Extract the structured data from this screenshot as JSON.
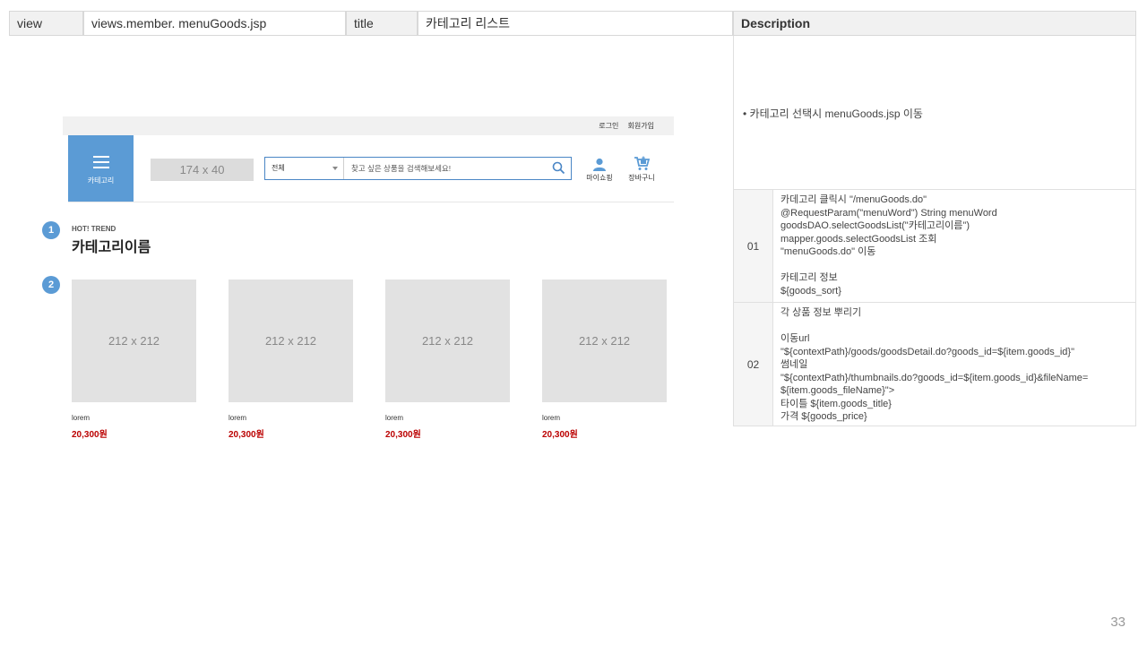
{
  "header": {
    "view_label": "view",
    "view_value": "views.member. menuGoods.jsp",
    "title_label": "title",
    "title_value": "카테고리 리스트"
  },
  "description": {
    "heading": "Description",
    "bullet": "카테고리 선택시 menuGoods.jsp  이동",
    "rows": [
      {
        "num": "01",
        "lines": [
          "카데고리 클릭시 \"/menuGoods.do\"",
          "@RequestParam(\"menuWord\") String menuWord",
          "goodsDAO.selectGoodsList(\"카테고리이름\")",
          "mapper.goods.selectGoodsList 조회",
          "\"menuGoods.do\" 이동",
          "",
          "카테고리 정보",
          "${goods_sort}"
        ]
      },
      {
        "num": "02",
        "lines": [
          "각 상품 정보 뿌리기",
          "",
          "이동url",
          "\"${contextPath}/goods/goodsDetail.do?goods_id=${item.goods_id}\"",
          "썸네일",
          "\"${contextPath}/thumbnails.do?goods_id=${item.goods_id}&fileName=",
          "${item.goods_fileName}\">",
          "타이틀 ${item.goods_title}",
          "가격  ${goods_price}"
        ]
      }
    ]
  },
  "mock": {
    "top_links": [
      "로그인",
      "회원가입"
    ],
    "category_button": "카테고리",
    "logo_placeholder": "174 x 40",
    "search_select": "전체",
    "search_placeholder": "찾고 싶은 상품을 검색해보세요!",
    "mypage_label": "마이쇼핑",
    "cart_label": "장바구니",
    "badge1": "1",
    "badge2": "2",
    "hot_trend": "HOT! TREND",
    "category_title": "카테고리이름",
    "products": [
      {
        "thumb": "212 x 212",
        "name": "lorem",
        "price": "20,300원"
      },
      {
        "thumb": "212 x 212",
        "name": "lorem",
        "price": "20,300원"
      },
      {
        "thumb": "212 x 212",
        "name": "lorem",
        "price": "20,300원"
      },
      {
        "thumb": "212 x 212",
        "name": "lorem",
        "price": "20,300원"
      }
    ]
  },
  "colors": {
    "accent": "#5b9bd5",
    "price": "#b00000",
    "placeholder_gray": "#e2e2e2"
  },
  "page_number": "33"
}
